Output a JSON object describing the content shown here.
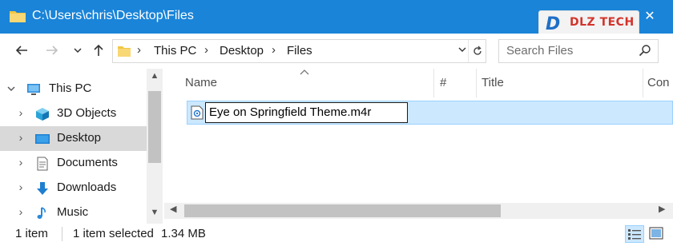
{
  "window": {
    "title": "C:\\Users\\chris\\Desktop\\Files",
    "minimize_glyph": "—",
    "maximize_glyph": "☐",
    "close_glyph": "✕"
  },
  "watermark": {
    "mark": "D",
    "text": "DLZ TECH"
  },
  "nav": {
    "back_icon": "arrow-left-icon",
    "forward_icon": "arrow-right-icon",
    "recent_icon": "chevron-down-icon",
    "up_icon": "arrow-up-icon",
    "breadcrumbs": [
      "This PC",
      "Desktop",
      "Files"
    ],
    "refresh_icon": "refresh-icon"
  },
  "search": {
    "placeholder": "Search Files",
    "icon": "search-icon"
  },
  "tree": {
    "items": [
      {
        "label": "This PC",
        "icon": "computer-icon",
        "expanded": true,
        "selected": false
      },
      {
        "label": "3D Objects",
        "icon": "cube-icon",
        "expanded": false,
        "selected": false
      },
      {
        "label": "Desktop",
        "icon": "desktop-icon",
        "expanded": false,
        "selected": true
      },
      {
        "label": "Documents",
        "icon": "document-icon",
        "expanded": false,
        "selected": false
      },
      {
        "label": "Downloads",
        "icon": "download-icon",
        "expanded": false,
        "selected": false
      },
      {
        "label": "Music",
        "icon": "music-icon",
        "expanded": false,
        "selected": false
      }
    ]
  },
  "list": {
    "columns": [
      "Name",
      "#",
      "Title",
      "Con"
    ],
    "sort_column": "Name",
    "sort_direction": "ascending",
    "files": [
      {
        "name": "Eye on Springfield Theme.m4r",
        "icon": "audio-file-icon",
        "renaming": true,
        "selected": true
      }
    ]
  },
  "status": {
    "item_count": "1 item",
    "selected": "1 item selected",
    "size": "1.34 MB",
    "views": [
      "details-view-icon",
      "large-icons-view-icon"
    ],
    "active_view": "details-view-icon"
  },
  "colors": {
    "titlebar": "#1a84d8",
    "selection": "#cce8ff",
    "selection_border": "#99d1ff",
    "tree_selected": "#d9d9d9",
    "folder": "#f2c744"
  }
}
